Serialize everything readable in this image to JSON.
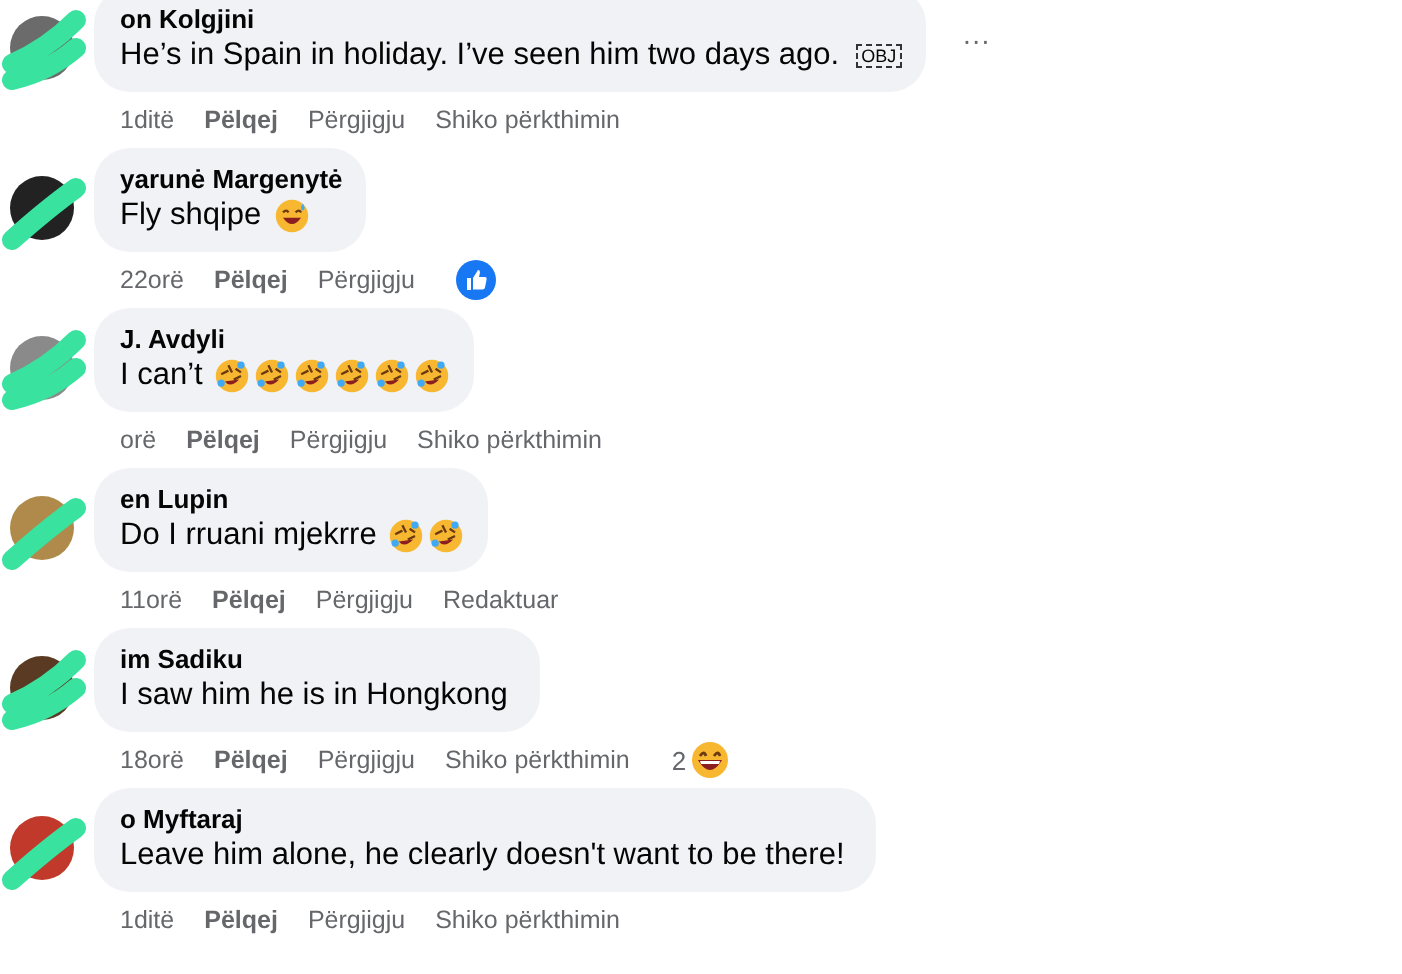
{
  "comments": [
    {
      "author": "on Kolgjini",
      "text": "He’s in Spain in holiday. I’ve seen him two days ago.",
      "badge": "OBJ",
      "more": "···",
      "actions": [
        "1ditë",
        "Pëlqej",
        "Përgjigju",
        "Shiko përkthimin"
      ]
    },
    {
      "author": "yarunė Margenytė",
      "text": "Fly shqipe",
      "emojis": [
        {
          "kind": "sweat-smile"
        }
      ],
      "actions": [
        "22orë",
        "Pëlqej",
        "Përgjigju"
      ],
      "reaction": {
        "kind": "like"
      }
    },
    {
      "author": "J. Avdyli",
      "text": "I can’t",
      "emojis": [
        {
          "kind": "rofl"
        },
        {
          "kind": "rofl"
        },
        {
          "kind": "rofl"
        },
        {
          "kind": "rofl"
        },
        {
          "kind": "rofl"
        },
        {
          "kind": "rofl"
        }
      ],
      "actions": [
        "orë",
        "Pëlqej",
        "Përgjigju",
        "Shiko përkthimin"
      ]
    },
    {
      "author": "en Lupin",
      "text": "Do I rruani mjekrre",
      "emojis": [
        {
          "kind": "rofl"
        },
        {
          "kind": "rofl"
        }
      ],
      "actions": [
        "11orë",
        "Pëlqej",
        "Përgjigju",
        "Redaktuar"
      ]
    },
    {
      "author": "im Sadiku",
      "text": "I saw him he is in Hongkong",
      "actions": [
        "18orë",
        "Pëlqej",
        "Përgjigju",
        "Shiko përkthimin"
      ],
      "reaction": {
        "kind": "grin",
        "count": "2"
      }
    },
    {
      "author": "o Myftaraj",
      "text": "Leave him alone, he clearly doesn't want to be there!",
      "actions": [
        "1ditë",
        "Pëlqej",
        "Përgjigju",
        "Shiko përkthimin"
      ]
    }
  ]
}
